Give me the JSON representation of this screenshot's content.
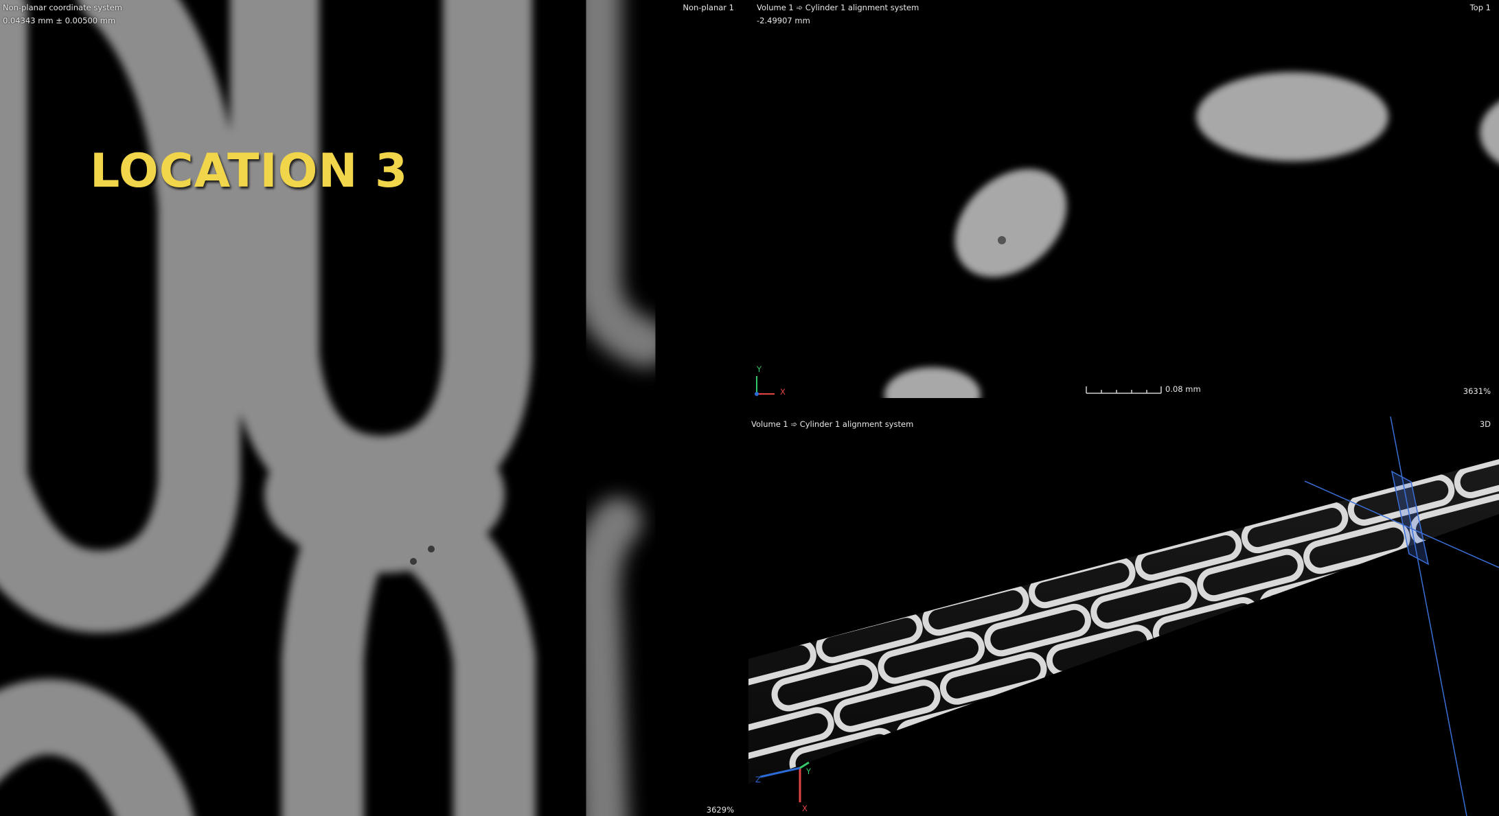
{
  "left_view": {
    "title": "Non-planar coordinate system",
    "measurement": "0.04343 mm ± 0.00500 mm",
    "view_name": "Non-planar 1",
    "overlay_text": "LOCATION 3",
    "zoom": "3629%"
  },
  "top_view": {
    "title": "Volume 1 ➾ Cylinder 1 alignment system",
    "value": "-2.49907 mm",
    "view_name": "Top 1",
    "scale_label": "0.08 mm",
    "axis_x": "X",
    "axis_y": "Y",
    "zoom": "3631%"
  },
  "view_3d": {
    "title": "Volume 1 ➾ Cylinder 1 alignment system",
    "view_name": "3D",
    "axis_x": "X",
    "axis_y": "Y",
    "axis_z": "Z"
  }
}
